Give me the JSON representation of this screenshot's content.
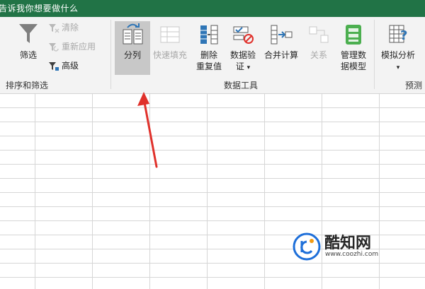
{
  "tellme": {
    "text": "告诉我你想要做什么"
  },
  "groups": {
    "sort_filter": {
      "label": "排序和筛选"
    },
    "data_tools": {
      "label": "数据工具"
    },
    "forecast": {
      "label": "预测"
    }
  },
  "buttons": {
    "filter": "筛选",
    "clear": "清除",
    "reapply": "重新应用",
    "advanced": "高级",
    "text_to_columns": "分列",
    "flash_fill": "快速填充",
    "remove_dup_1": "删除",
    "remove_dup_2": "重复值",
    "validation_1": "数据验",
    "validation_2": "证",
    "consolidate": "合并计算",
    "relationships": "关系",
    "manage_model_1": "管理数",
    "manage_model_2": "据模型",
    "whatif": "模拟分析"
  },
  "watermark": {
    "title": "酷知网",
    "url": "www.coozhi.com"
  },
  "colors": {
    "title_bar": "#217346",
    "arrow": "#e0312b",
    "pressed": "#c8c8c8"
  }
}
